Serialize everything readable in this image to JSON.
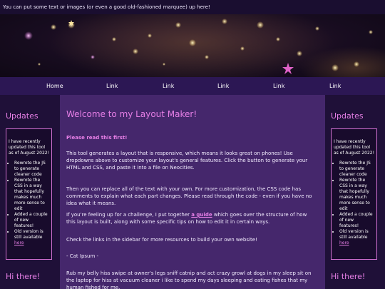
{
  "topbar": {
    "marquee_text": "You can put some text or images (or even a good old-fashioned marquee) up here!"
  },
  "nav": {
    "items": [
      "Home",
      "Link",
      "Link",
      "Link",
      "Link",
      "Link"
    ]
  },
  "sidebar": {
    "title": "Updates",
    "intro": "I have recently updated this tool as of August 2022!",
    "items": [
      "Rewrote the JS to generate cleaner code",
      "Rewrote the CSS in a way that hopefully makes much more sense to edit",
      "Added a couple of new features!",
      "Old version is still available"
    ],
    "here_link": "here",
    "bottom_title": "Hi there!"
  },
  "main": {
    "title": "Welcome to my Layout Maker!",
    "subtitle": "Please read this first!",
    "p1": "This tool generates a layout that is responsive, which means it looks great on phones! Use dropdowns above to customize your layout's general features. Click the button to generate your HTML and CSS, and paste it into a file on Neocities.",
    "p2": "Then you can replace all of the text with your own. For more customization, the CSS code has comments to explain what each part changes. Please read through the code - even if you have no idea what it means.",
    "p3_before": "If you're feeling up for a challenge, I put together",
    "p3_link": "a guide",
    "p3_after": "which goes over the structure of how this layout is built, along with some specific tips on how to edit it in certain ways.",
    "p4": "Check the links in the sidebar for more resources to build your own website!",
    "p5": "- Cat Ipsum -",
    "p6": "Rub my belly hiss swipe at owner's legs sniff catnip and act crazy growl at dogs in my sleep sit on the laptop for hiss at vacuum cleaner i like to spend my days sleeping and eating fishes that my human fished for me."
  }
}
